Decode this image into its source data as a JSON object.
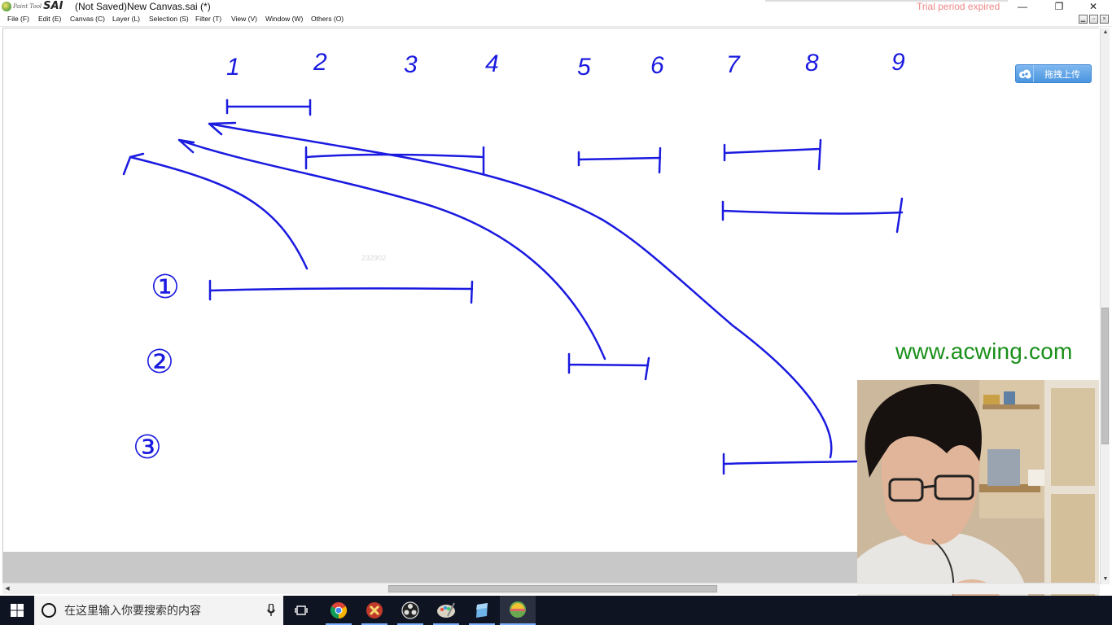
{
  "window": {
    "app_logo_small": "Paint Tool",
    "app_logo_large": "SAI",
    "title": "(Not Saved)New Canvas.sai (*)",
    "trial_notice": "Trial period expired",
    "controls": {
      "minimize": "—",
      "restore": "❐",
      "close": "✕"
    }
  },
  "menu": [
    {
      "label": "File (F)"
    },
    {
      "label": "Edit (E)"
    },
    {
      "label": "Canvas (C)"
    },
    {
      "label": "Layer (L)"
    },
    {
      "label": "Selection (S)"
    },
    {
      "label": "Filter (T)"
    },
    {
      "label": "View (V)"
    },
    {
      "label": "Window (W)"
    },
    {
      "label": "Others (O)"
    }
  ],
  "canvas": {
    "column_numbers": [
      "1",
      "2",
      "3",
      "4",
      "5",
      "6",
      "7",
      "8",
      "9"
    ],
    "row_markers": [
      "①",
      "②",
      "③"
    ],
    "faint_text": "232902",
    "ink_color": "#1a1ae0"
  },
  "overlay": {
    "upload_label": "拖拽上传",
    "watermark": "www.acwing.com",
    "watermark_color": "#1a8f1a"
  },
  "taskbar": {
    "search_placeholder": "在这里输入你要搜索的内容",
    "apps": [
      "task-view",
      "chrome",
      "app-red",
      "obs",
      "paint-tool",
      "app-blue",
      "paint-tool-sai"
    ]
  }
}
